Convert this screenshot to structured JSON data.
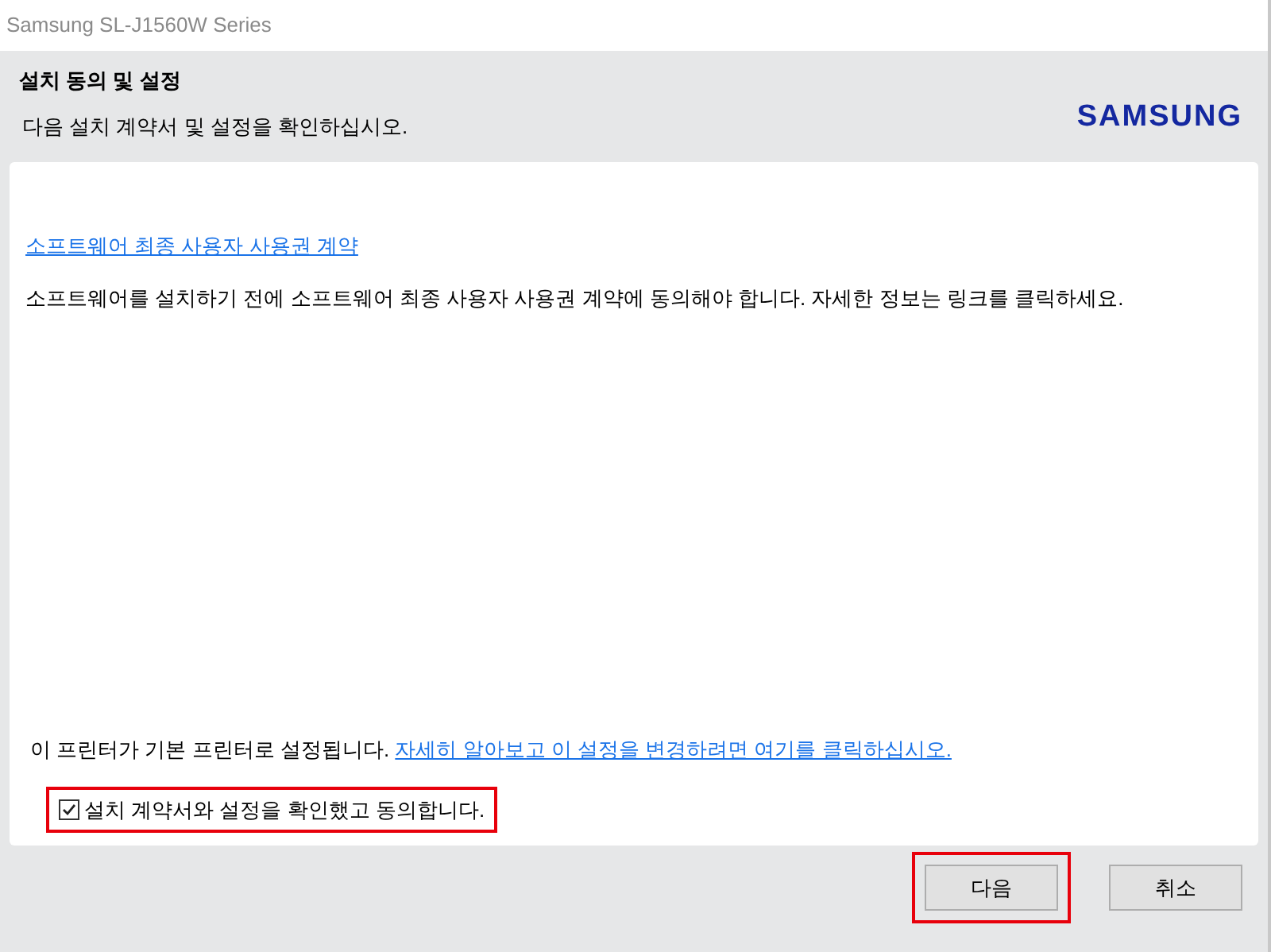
{
  "window": {
    "title": "Samsung SL-J1560W Series"
  },
  "header": {
    "title": "설치 동의 및 설정",
    "subtitle": "다음 설치 계약서 및 설정을 확인하십시오.",
    "logo": "SAMSUNG"
  },
  "content": {
    "eula_link": "소프트웨어 최종 사용자 사용권 계약",
    "description": "소프트웨어를 설치하기 전에 소프트웨어 최종 사용자 사용권 계약에 동의해야 합니다. 자세한 정보는 링크를 클릭하세요.",
    "default_printer_text": "이 프린터가 기본 프린터로 설정됩니다.",
    "default_printer_link": "자세히 알아보고 이 설정을 변경하려면 여기를 클릭하십시오.",
    "agree": {
      "label": "설치 계약서와 설정을 확인했고 동의합니다.",
      "checked": true,
      "highlighted": true
    }
  },
  "buttons": [
    {
      "label": "다음",
      "highlighted": true
    },
    {
      "label": "취소",
      "highlighted": false
    }
  ]
}
